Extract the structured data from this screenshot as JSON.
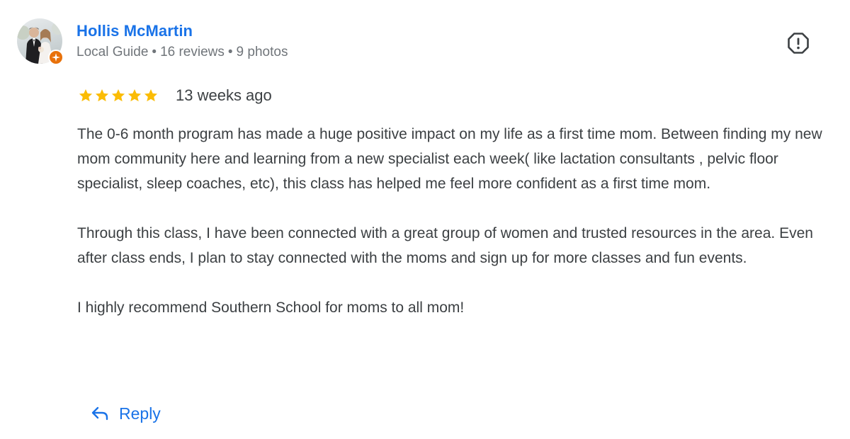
{
  "review": {
    "author": {
      "name": "Hollis McMartin",
      "level": "Local Guide",
      "reviews": "16 reviews",
      "photos": "9 photos",
      "separator": "•",
      "avatar_icon": "user-photo-avatar",
      "badge_icon": "local-guide-star-badge"
    },
    "rating": {
      "stars_filled": 5,
      "stars_total": 5,
      "star_color": "#fbbc04"
    },
    "date": "13 weeks ago",
    "paragraphs": [
      "The 0-6 month program has made a huge positive impact on my life as a first time mom. Between finding my new mom community here and learning from a new specialist each week( like lactation consultants , pelvic floor specialist, sleep coaches, etc), this class has helped me feel more confident as a first time mom.",
      "Through this class, I have been connected with a great group of women and trusted resources in the area. Even after class ends, I plan to stay connected with the moms and sign up for more classes and fun events.",
      "I highly recommend Southern School for moms to all mom!"
    ],
    "actions": {
      "reply_label": "Reply",
      "reply_icon": "reply-arrow-icon",
      "report_icon": "report-octagon-icon"
    },
    "colors": {
      "accent": "#1a73e8",
      "badge": "#e8710a",
      "meta_text": "#70757a"
    }
  }
}
